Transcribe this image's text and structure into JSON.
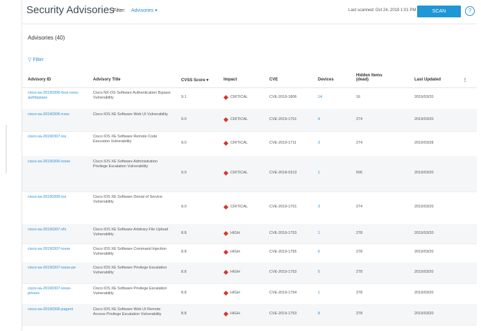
{
  "header": {
    "title": "Security Advisories",
    "filter_label": "Filter:",
    "filter_value": "Advisories ▾",
    "last_scanned": "Last scanned: Oct 24, 2019 1:01 PM",
    "scan_button": "SCAN",
    "help_icon": "help-icon"
  },
  "section": {
    "title": "Advisories (40)",
    "filter_link": "▽ Filter"
  },
  "table": {
    "columns": [
      "Advisory ID",
      "Advisory Title",
      "CVSS Score ▾",
      "Impact",
      "CVE",
      "Devices",
      "Hidden Items (dead)",
      "Last Updated",
      "⋮"
    ],
    "rows": [
      {
        "id": "cisco-sa-20190306-fxos-nxos-authbypass",
        "title": "Cisco NX-OS Software Authentication Bypass Vulnerability",
        "score": "9.1",
        "impact": "CRITICAL",
        "cve": "CVE-2019-1806",
        "devices": "14",
        "hidden": "16",
        "updated": "2019/03/20"
      },
      {
        "id": "cisco-sa-20190306-nxos",
        "title": "Cisco IOS XE Software Web UI Vulnerability",
        "score": "9.0",
        "impact": "CRITICAL",
        "cve": "CVE-2019-1701",
        "devices": "9",
        "hidden": "274",
        "updated": "2019/03/20"
      },
      {
        "id": "cisco-sa-20190307-ios",
        "title": "Cisco IOS XE Software Remote Code Execution Vulnerability",
        "score": "9.0",
        "impact": "CRITICAL",
        "cve": "CVE-2019-1711",
        "devices": "3",
        "hidden": "274",
        "updated": "2019/03/28"
      },
      {
        "id": "cisco-sa-20190306-iosxe",
        "title": "Cisco IOS XE Software Administration Privilege Escalation Vulnerability",
        "score": "9.0",
        "impact": "CRITICAL",
        "cve": "CVE-2018-0313",
        "devices": "1",
        "hidden": "506",
        "updated": "2019/03/20"
      },
      {
        "id": "cisco-sa-20190306-ios",
        "title": "Cisco IOS XE Software Denial of Service Vulnerability",
        "score": "9.0",
        "impact": "CRITICAL",
        "cve": "CVE-2019-1701",
        "devices": "3",
        "hidden": "274",
        "updated": "2019/03/20"
      },
      {
        "id": "cisco-sa-20190307-xfs",
        "title": "Cisco IOS XE Software Arbitrary File Upload Vulnerability",
        "score": "8.8",
        "impact": "HIGH",
        "cve": "CVE-2019-1753",
        "devices": "1",
        "hidden": "278",
        "updated": "2019/03/20"
      },
      {
        "id": "cisco-sa-20190307-iosxe",
        "title": "Cisco IOS XE Software Command Injection Vulnerability",
        "score": "8.8",
        "impact": "HIGH",
        "cve": "CVE-2019-1755",
        "devices": "6",
        "hidden": "278",
        "updated": "2019/03/20"
      },
      {
        "id": "cisco-sa-20190307-iosxe-pe",
        "title": "Cisco IOS XE Software Privilege Escalation Vulnerability",
        "score": "8.8",
        "impact": "HIGH",
        "cve": "CVE-2019-1753",
        "devices": "5",
        "hidden": "278",
        "updated": "2019/03/20"
      },
      {
        "id": "cisco-sa-20190307-iosxe-privesc",
        "title": "Cisco IOS XE Software Privilege Escalation Vulnerability",
        "score": "8.8",
        "impact": "HIGH",
        "cve": "CVE-2019-1754",
        "devices": "1",
        "hidden": "278",
        "updated": "2019/03/20"
      },
      {
        "id": "cisco-sa-20190306-pagent",
        "title": "Cisco IOS XE Software Web UI Remote Access Privilege Escalation Vulnerability",
        "score": "8.8",
        "impact": "HIGH",
        "cve": "CVE-2019-1753",
        "devices": "8",
        "hidden": "278",
        "updated": "2019/03/20"
      }
    ]
  },
  "colors": {
    "link": "#2a8fd6",
    "critical": "#d8352a",
    "button": "#1f96d6"
  }
}
